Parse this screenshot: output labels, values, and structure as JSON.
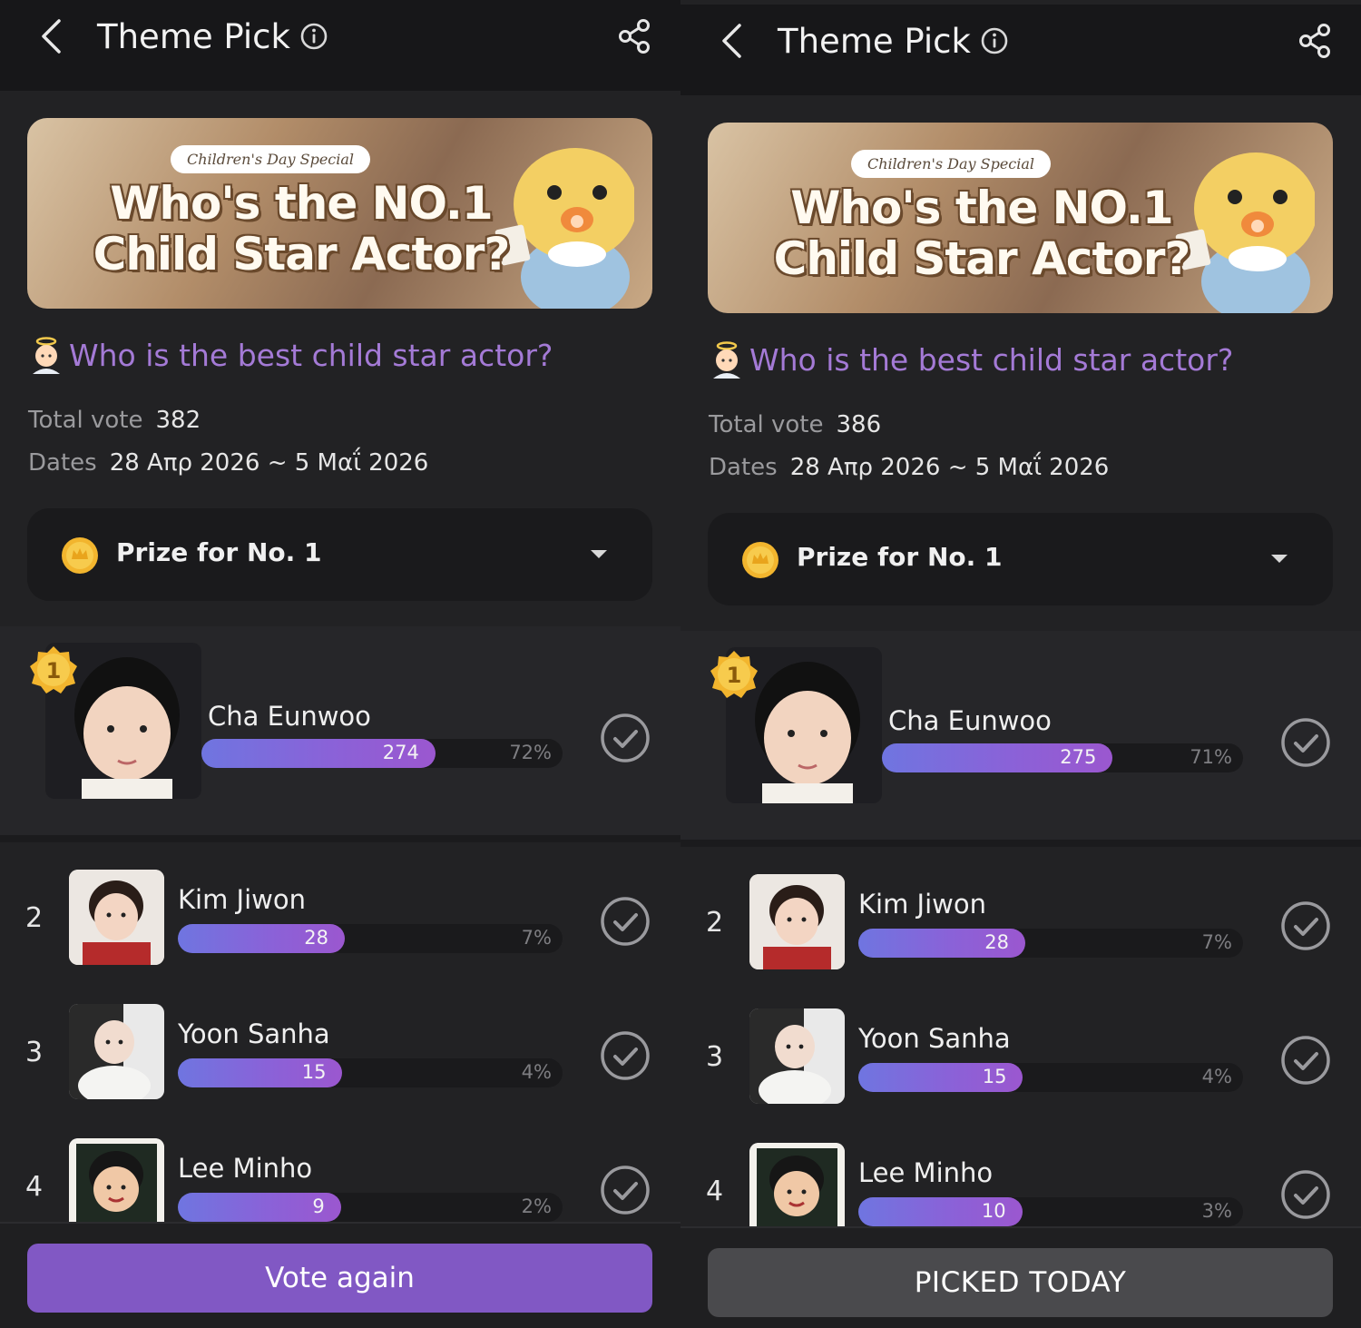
{
  "colors": {
    "accent": "#8158c4",
    "question": "#a47ad6",
    "bar_start": "#6f75e0",
    "bar_end": "#9b57cf",
    "background": "#222224"
  },
  "left": {
    "header": {
      "title": "Theme Pick"
    },
    "banner": {
      "tag": "Children's Day Special",
      "line1": "Who's the NO.1",
      "line2": "Child Star Actor?"
    },
    "question": "Who is the best child star actor?",
    "total_vote_label": "Total vote",
    "total_vote": "382",
    "dates_label": "Dates",
    "dates": "28 Απρ 2026 ~ 5 Μαΐ 2026",
    "prize_label": "Prize for No. 1",
    "candidates": [
      {
        "rank": "1",
        "name": "Cha Eunwoo",
        "votes": "274",
        "pct": "72%",
        "share": 0.72
      },
      {
        "rank": "2",
        "name": "Kim Jiwon",
        "votes": "28",
        "pct": "7%",
        "share": 0.07
      },
      {
        "rank": "3",
        "name": "Yoon Sanha",
        "votes": "15",
        "pct": "4%",
        "share": 0.04
      },
      {
        "rank": "4",
        "name": "Lee Minho",
        "votes": "9",
        "pct": "2%",
        "share": 0.02
      }
    ],
    "button": "Vote again"
  },
  "right": {
    "header": {
      "title": "Theme Pick"
    },
    "banner": {
      "tag": "Children's Day Special",
      "line1": "Who's the NO.1",
      "line2": "Child Star Actor?"
    },
    "question": "Who is the best child star actor?",
    "total_vote_label": "Total vote",
    "total_vote": "386",
    "dates_label": "Dates",
    "dates": "28 Απρ 2026 ~ 5 Μαΐ 2026",
    "prize_label": "Prize for No. 1",
    "candidates": [
      {
        "rank": "1",
        "name": "Cha Eunwoo",
        "votes": "275",
        "pct": "71%",
        "share": 0.71
      },
      {
        "rank": "2",
        "name": "Kim Jiwon",
        "votes": "28",
        "pct": "7%",
        "share": 0.07
      },
      {
        "rank": "3",
        "name": "Yoon Sanha",
        "votes": "15",
        "pct": "4%",
        "share": 0.04
      },
      {
        "rank": "4",
        "name": "Lee Minho",
        "votes": "10",
        "pct": "3%",
        "share": 0.03
      }
    ],
    "button": "PICKED TODAY"
  },
  "icons": {
    "back": "chevron-left-icon",
    "info": "info-icon",
    "share": "share-icon",
    "coin": "coin-icon",
    "caret": "caret-down-icon",
    "check": "check-circle-icon",
    "medal": "gold-medal-icon",
    "question_emoji": "angel-baby-icon"
  }
}
